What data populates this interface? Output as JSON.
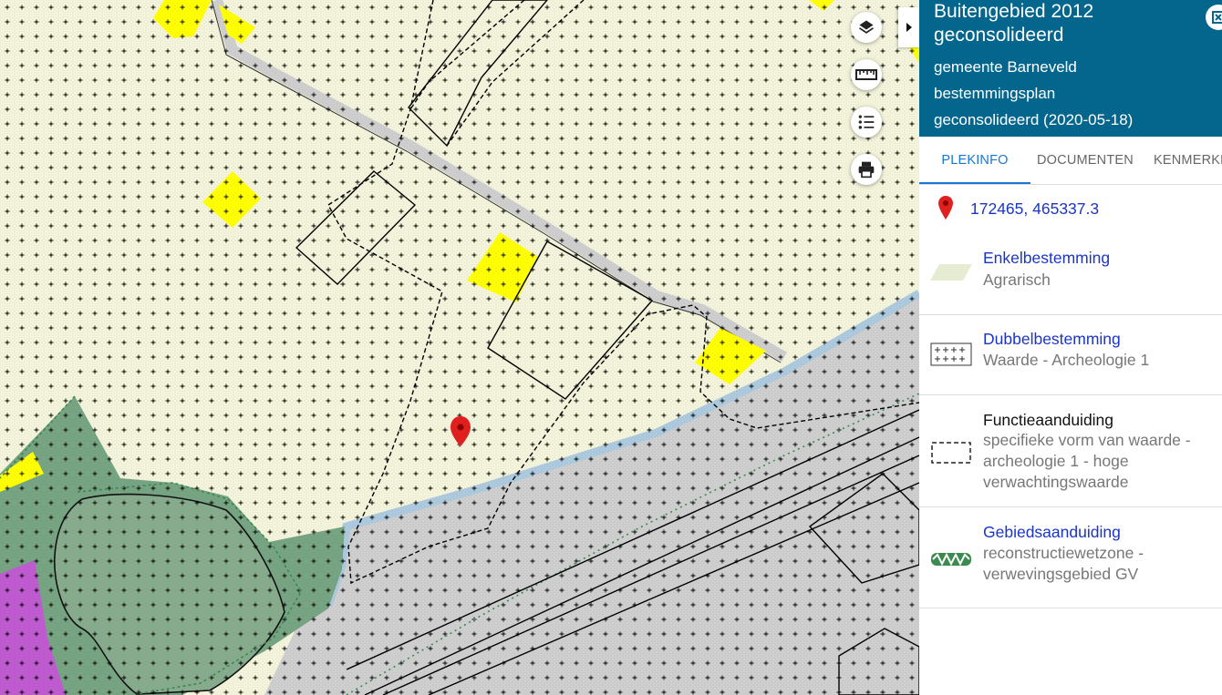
{
  "map": {
    "colors": {
      "agrarisch": "#f1f2d9",
      "verkeer": "#cdcdcd",
      "water": "#abc8dc",
      "natuur": "#86ab8c",
      "natuur_dark": "#76a382",
      "bedrijf": "#ffff00",
      "maatschappelijk": "#bd5bcf",
      "marker": "#e0201f"
    },
    "tools": [
      {
        "name": "layers-icon"
      },
      {
        "name": "ruler-icon"
      },
      {
        "name": "legend-list-icon"
      },
      {
        "name": "print-icon"
      }
    ],
    "collapse_icon": "chevron-right-icon"
  },
  "panel": {
    "plan_title": "Buitengebied 2012 geconsolideerd",
    "plan_municipality": "gemeente Barneveld",
    "plan_type": "bestemmingsplan",
    "plan_status": "geconsolideerd (2020-05-18)",
    "tabs": [
      "PLEKINFO",
      "DOCUMENTEN",
      "KENMERKEN"
    ],
    "active_tab": "PLEKINFO",
    "coordinates": "172465, 465337.3",
    "items": [
      {
        "title": "Enkelbestemming",
        "desc": "Agrarisch",
        "link": true,
        "symbol": "agrarisch-swatch"
      },
      {
        "title": "Dubbelbestemming",
        "desc": "Waarde - Archeologie 1",
        "link": true,
        "symbol": "archeologie-cross-pattern"
      },
      {
        "title": "Functieaanduiding",
        "desc": "specifieke vorm van waarde - archeologie 1 - hoge verwachtingswaarde",
        "link": false,
        "symbol": "dashed-rectangle"
      },
      {
        "title": "Gebiedsaanduiding",
        "desc": "reconstructiewetzone - verwevingsgebied GV",
        "link": true,
        "symbol": "zigzag-green-line"
      }
    ]
  }
}
